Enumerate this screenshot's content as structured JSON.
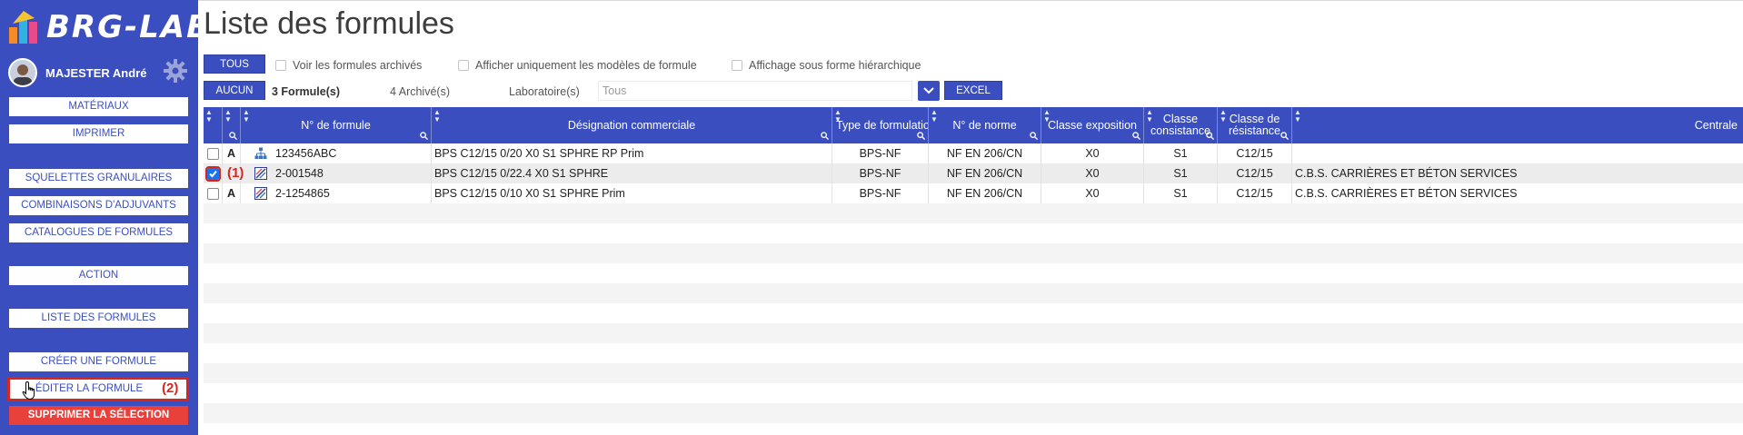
{
  "app": {
    "brand": "BRG-LAB"
  },
  "user": {
    "name": "MAJESTER André"
  },
  "sidebar": {
    "materiaux": "MATÉRIAUX",
    "imprimer": "IMPRIMER",
    "squelettes": "SQUELETTES GRANULAIRES",
    "combinaisons": "COMBINAISONS D'ADJUVANTS",
    "catalogues": "CATALOGUES DE FORMULES",
    "action": "ACTION",
    "liste": "LISTE DES FORMULES",
    "creer": "CRÉER UNE FORMULE",
    "editer": "ÉDITER LA FORMULE",
    "supprimer": "SUPPRIMER LA SÉLECTION"
  },
  "callouts": {
    "one": "(1)",
    "two": "(2)"
  },
  "page": {
    "title": "Liste des formules"
  },
  "toolbar": {
    "tous": "TOUS",
    "aucun": "AUCUN",
    "voir_archives": "Voir les formules archivés",
    "modeles": "Afficher uniquement les modèles de formule",
    "hierarchique": "Affichage sous forme hiérarchique",
    "count_formules": "3 Formule(s)",
    "count_archives": "4 Archivé(s)",
    "laboratoire_label": "Laboratoire(s)",
    "laboratoire_placeholder": "Tous",
    "excel": "EXCEL"
  },
  "table": {
    "columns": [
      "N° de formule",
      "Désignation commerciale",
      "Type de formulation",
      "N° de norme",
      "Classe exposition",
      "Classe consistance",
      "Classe de résistance",
      "Centrale"
    ],
    "column_lines": {
      "consistance": [
        "Classe",
        "consistance"
      ],
      "resistance": [
        "Classe de",
        "résistance"
      ]
    },
    "rows": [
      {
        "checked": false,
        "flag": "A",
        "icon": "hierarchy-icon",
        "numero": "123456ABC",
        "designation": "BPS C12/15 0/20 X0 S1 SPHRE RP Prim",
        "type": "BPS-NF",
        "norme": "NF EN 206/CN",
        "exposition": "X0",
        "consistance": "S1",
        "resistance": "C12/15",
        "centrale": ""
      },
      {
        "checked": true,
        "flag": "",
        "icon": "formula-icon",
        "numero": "2-001548",
        "designation": "BPS C12/15 0/22.4 X0 S1 SPHRE",
        "type": "BPS-NF",
        "norme": "NF EN 206/CN",
        "exposition": "X0",
        "consistance": "S1",
        "resistance": "C12/15",
        "centrale": "C.B.S. CARRIÈRES ET BÉTON SERVICES"
      },
      {
        "checked": false,
        "flag": "A",
        "icon": "formula-icon",
        "numero": "2-1254865",
        "designation": "BPS C12/15 0/10 X0 S1 SPHRE Prim",
        "type": "BPS-NF",
        "norme": "NF EN 206/CN",
        "exposition": "X0",
        "consistance": "S1",
        "resistance": "C12/15",
        "centrale": "C.B.S. CARRIÈRES ET BÉTON SERVICES"
      }
    ]
  },
  "colors": {
    "primary": "#3a4ec0",
    "danger": "#e8413c",
    "highlight": "#d7261e"
  }
}
